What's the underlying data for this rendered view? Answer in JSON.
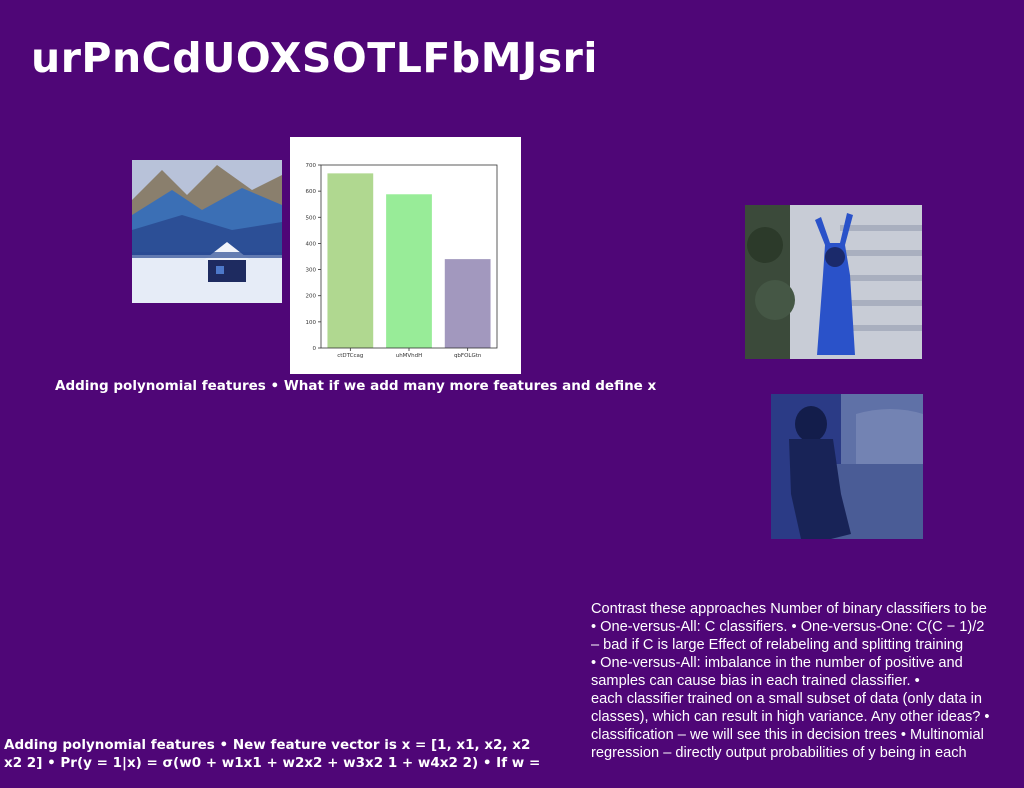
{
  "slide": {
    "title": "urPnCdUOXSOTLFbMJsri",
    "caption_top": "Adding polynomial features • What if we add many more features and define x",
    "caption_bottom": [
      "Adding polynomial features • New feature vector is x = [1, x1, x2, x2",
      "x2 2] • Pr(y = 1|x) = σ(w0 + w1x1 + w2x2 + w3x2 1 + w4x2 2) • If w ="
    ],
    "body_lines": [
      "Contrast these approaches Number of binary classifiers to be",
      "• One-versus-All: C classifiers. • One-versus-One: C(C − 1)/2",
      "– bad if C is large Effect of relabeling and splitting training",
      "• One-versus-All: imbalance in the number of positive and",
      "samples can cause bias in each trained classifier. •",
      "each classifier trained on a small subset of data (only data in",
      "classes), which can result in high variance. Any other ideas? •",
      "classification – we will see this in decision trees • Multinomial",
      "regression – directly output probabilities of y being in each"
    ],
    "images": [
      "snowy-mountain-cabin-photo",
      "woman-arms-raised-photo",
      "person-sitting-couch-photo"
    ]
  },
  "chart_data": {
    "type": "bar",
    "categories": [
      "ctDTCcag",
      "uhMVhdH",
      "qbFOLGtn"
    ],
    "values": [
      668,
      588,
      340
    ],
    "colors": [
      "#b0d890",
      "#98ec98",
      "#a298be"
    ],
    "ylim": [
      0,
      700
    ],
    "yticks": [
      0,
      100,
      200,
      300,
      400,
      500,
      600,
      700
    ],
    "title": "",
    "xlabel": "",
    "ylabel": ""
  }
}
